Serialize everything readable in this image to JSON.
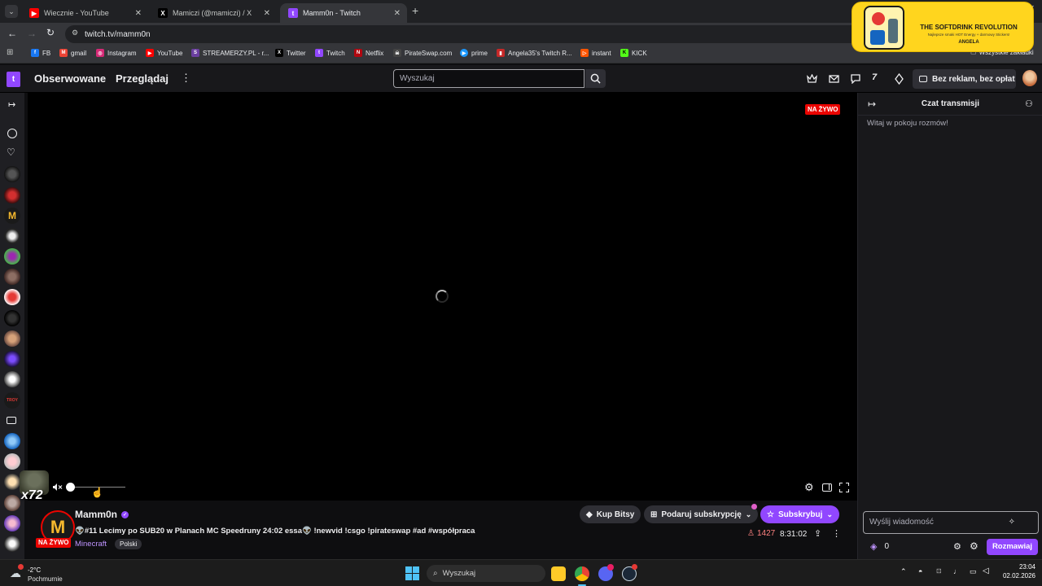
{
  "browser": {
    "tabs": [
      {
        "title": "Wiecznie - YouTube",
        "icon": "youtube-icon"
      },
      {
        "title": "Mamiczi (@mamiczi) / X",
        "icon": "x-icon"
      },
      {
        "title": "Mamm0n - Twitch",
        "icon": "twitch-icon"
      }
    ],
    "url": "twitch.tv/mamm0n",
    "bookmarks": [
      {
        "label": "FB"
      },
      {
        "label": "gmail"
      },
      {
        "label": "Instagram"
      },
      {
        "label": "YouTube"
      },
      {
        "label": "STREAMERZY.PL - r..."
      },
      {
        "label": "Twitter"
      },
      {
        "label": "Twitch"
      },
      {
        "label": "Netflix"
      },
      {
        "label": "PirateSwap.com"
      },
      {
        "label": "prime"
      },
      {
        "label": "Angela35's Twitch R..."
      },
      {
        "label": "instant"
      },
      {
        "label": "KICK"
      }
    ],
    "all_bookmarks": "Wszystkie zakładki",
    "ad_banner": {
      "title": "THE SOFTDRINK REVOLUTION",
      "subtitle": "Najlepsze smaki HOT Energy + darmowy Stickers!",
      "name": "ANGELA"
    }
  },
  "twitch_nav": {
    "followed": "Obserwowane",
    "browse": "Przeglądaj",
    "search_placeholder": "Wyszukaj",
    "turbo": "Bez reklam, bez opłat"
  },
  "player": {
    "live_badge": "NA ŻYWO",
    "volume_level": 0,
    "overlay_text": "x72"
  },
  "stream": {
    "channel": "Mamm0n",
    "title": "👽#11 Lecimy po SUB20 w Planach MC Speedruny 24:02 essa👽 !newvid !csgo !pirateswap #ad #współpraca",
    "live": "NA ŻYWO",
    "category": "Minecraft",
    "tag": "Polski",
    "viewers": "1427",
    "uptime": "8:31:02",
    "buy_bits": "Kup Bitsy",
    "gift_sub": "Podaruj subskrypcję",
    "subscribe": "Subskrybuj"
  },
  "chat": {
    "header": "Czat transmisji",
    "welcome": "Witaj w pokoju rozmów!",
    "input_placeholder": "Wyślij wiadomość",
    "points": "0",
    "send": "Rozmawiaj"
  },
  "taskbar": {
    "weather_temp": "-2°C",
    "weather_desc": "Pochmurnie",
    "search": "Wyszukaj",
    "time": "23:04",
    "date": "02.02.2026"
  },
  "colors": {
    "twitch_purple": "#9147ff",
    "live_red": "#eb0400",
    "background": "#0e0e10"
  }
}
